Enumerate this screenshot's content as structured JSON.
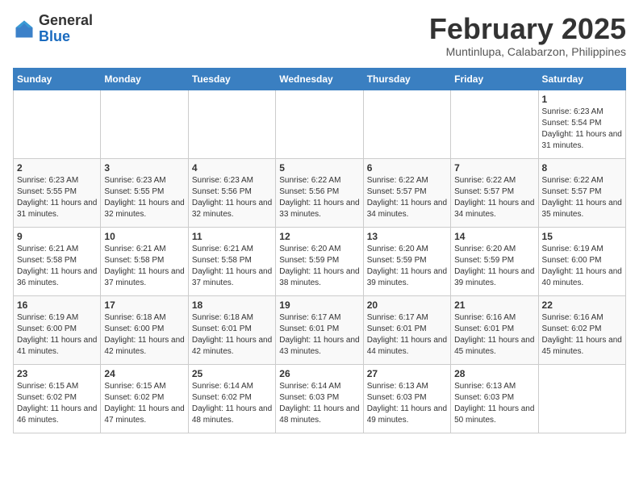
{
  "header": {
    "logo_line1": "General",
    "logo_line2": "Blue",
    "title": "February 2025",
    "subtitle": "Muntinlupa, Calabarzon, Philippines"
  },
  "days_of_week": [
    "Sunday",
    "Monday",
    "Tuesday",
    "Wednesday",
    "Thursday",
    "Friday",
    "Saturday"
  ],
  "weeks": [
    [
      {
        "day": "",
        "info": ""
      },
      {
        "day": "",
        "info": ""
      },
      {
        "day": "",
        "info": ""
      },
      {
        "day": "",
        "info": ""
      },
      {
        "day": "",
        "info": ""
      },
      {
        "day": "",
        "info": ""
      },
      {
        "day": "1",
        "info": "Sunrise: 6:23 AM\nSunset: 5:54 PM\nDaylight: 11 hours\nand 31 minutes."
      }
    ],
    [
      {
        "day": "2",
        "info": "Sunrise: 6:23 AM\nSunset: 5:55 PM\nDaylight: 11 hours\nand 31 minutes."
      },
      {
        "day": "3",
        "info": "Sunrise: 6:23 AM\nSunset: 5:55 PM\nDaylight: 11 hours\nand 32 minutes."
      },
      {
        "day": "4",
        "info": "Sunrise: 6:23 AM\nSunset: 5:56 PM\nDaylight: 11 hours\nand 32 minutes."
      },
      {
        "day": "5",
        "info": "Sunrise: 6:22 AM\nSunset: 5:56 PM\nDaylight: 11 hours\nand 33 minutes."
      },
      {
        "day": "6",
        "info": "Sunrise: 6:22 AM\nSunset: 5:57 PM\nDaylight: 11 hours\nand 34 minutes."
      },
      {
        "day": "7",
        "info": "Sunrise: 6:22 AM\nSunset: 5:57 PM\nDaylight: 11 hours\nand 34 minutes."
      },
      {
        "day": "8",
        "info": "Sunrise: 6:22 AM\nSunset: 5:57 PM\nDaylight: 11 hours\nand 35 minutes."
      }
    ],
    [
      {
        "day": "9",
        "info": "Sunrise: 6:21 AM\nSunset: 5:58 PM\nDaylight: 11 hours\nand 36 minutes."
      },
      {
        "day": "10",
        "info": "Sunrise: 6:21 AM\nSunset: 5:58 PM\nDaylight: 11 hours\nand 37 minutes."
      },
      {
        "day": "11",
        "info": "Sunrise: 6:21 AM\nSunset: 5:58 PM\nDaylight: 11 hours\nand 37 minutes."
      },
      {
        "day": "12",
        "info": "Sunrise: 6:20 AM\nSunset: 5:59 PM\nDaylight: 11 hours\nand 38 minutes."
      },
      {
        "day": "13",
        "info": "Sunrise: 6:20 AM\nSunset: 5:59 PM\nDaylight: 11 hours\nand 39 minutes."
      },
      {
        "day": "14",
        "info": "Sunrise: 6:20 AM\nSunset: 5:59 PM\nDaylight: 11 hours\nand 39 minutes."
      },
      {
        "day": "15",
        "info": "Sunrise: 6:19 AM\nSunset: 6:00 PM\nDaylight: 11 hours\nand 40 minutes."
      }
    ],
    [
      {
        "day": "16",
        "info": "Sunrise: 6:19 AM\nSunset: 6:00 PM\nDaylight: 11 hours\nand 41 minutes."
      },
      {
        "day": "17",
        "info": "Sunrise: 6:18 AM\nSunset: 6:00 PM\nDaylight: 11 hours\nand 42 minutes."
      },
      {
        "day": "18",
        "info": "Sunrise: 6:18 AM\nSunset: 6:01 PM\nDaylight: 11 hours\nand 42 minutes."
      },
      {
        "day": "19",
        "info": "Sunrise: 6:17 AM\nSunset: 6:01 PM\nDaylight: 11 hours\nand 43 minutes."
      },
      {
        "day": "20",
        "info": "Sunrise: 6:17 AM\nSunset: 6:01 PM\nDaylight: 11 hours\nand 44 minutes."
      },
      {
        "day": "21",
        "info": "Sunrise: 6:16 AM\nSunset: 6:01 PM\nDaylight: 11 hours\nand 45 minutes."
      },
      {
        "day": "22",
        "info": "Sunrise: 6:16 AM\nSunset: 6:02 PM\nDaylight: 11 hours\nand 45 minutes."
      }
    ],
    [
      {
        "day": "23",
        "info": "Sunrise: 6:15 AM\nSunset: 6:02 PM\nDaylight: 11 hours\nand 46 minutes."
      },
      {
        "day": "24",
        "info": "Sunrise: 6:15 AM\nSunset: 6:02 PM\nDaylight: 11 hours\nand 47 minutes."
      },
      {
        "day": "25",
        "info": "Sunrise: 6:14 AM\nSunset: 6:02 PM\nDaylight: 11 hours\nand 48 minutes."
      },
      {
        "day": "26",
        "info": "Sunrise: 6:14 AM\nSunset: 6:03 PM\nDaylight: 11 hours\nand 48 minutes."
      },
      {
        "day": "27",
        "info": "Sunrise: 6:13 AM\nSunset: 6:03 PM\nDaylight: 11 hours\nand 49 minutes."
      },
      {
        "day": "28",
        "info": "Sunrise: 6:13 AM\nSunset: 6:03 PM\nDaylight: 11 hours\nand 50 minutes."
      },
      {
        "day": "",
        "info": ""
      }
    ]
  ]
}
